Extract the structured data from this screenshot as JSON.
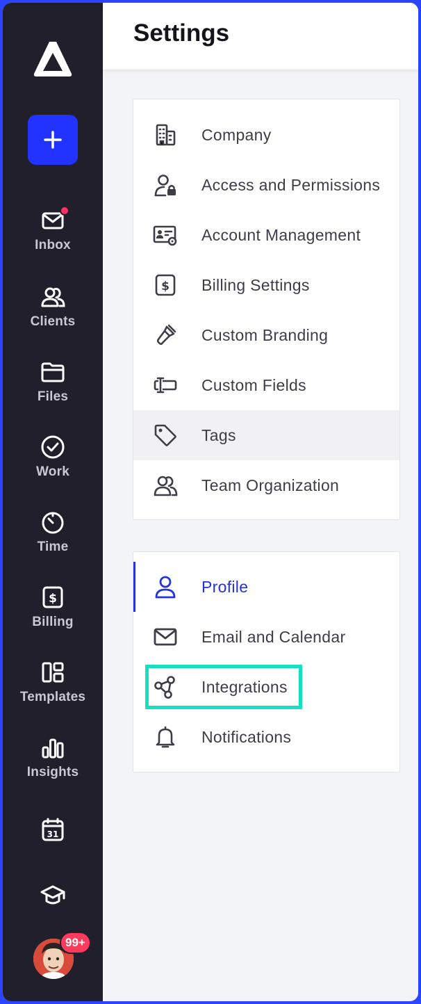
{
  "header": {
    "title": "Settings"
  },
  "sidebar": {
    "new_button": "+",
    "items": [
      {
        "label": "Inbox",
        "icon": "mail-icon"
      },
      {
        "label": "Clients",
        "icon": "users-icon"
      },
      {
        "label": "Files",
        "icon": "folder-icon"
      },
      {
        "label": "Work",
        "icon": "check-circle-icon"
      },
      {
        "label": "Time",
        "icon": "timer-icon"
      },
      {
        "label": "Billing",
        "icon": "dollar-square-icon"
      },
      {
        "label": "Templates",
        "icon": "templates-icon"
      },
      {
        "label": "Insights",
        "icon": "bar-chart-icon"
      }
    ],
    "calendar_day": "31",
    "notification_count": "99+"
  },
  "firm_settings": [
    {
      "label": "Company",
      "icon": "building-icon"
    },
    {
      "label": "Access and Permissions",
      "icon": "user-lock-icon"
    },
    {
      "label": "Account Management",
      "icon": "id-card-gear-icon"
    },
    {
      "label": "Billing Settings",
      "icon": "dollar-square-icon"
    },
    {
      "label": "Custom Branding",
      "icon": "paint-brush-icon"
    },
    {
      "label": "Custom Fields",
      "icon": "text-field-icon"
    },
    {
      "label": "Tags",
      "icon": "tag-icon"
    },
    {
      "label": "Team Organization",
      "icon": "team-icon"
    }
  ],
  "personal_settings": [
    {
      "label": "Profile",
      "icon": "user-icon"
    },
    {
      "label": "Email and Calendar",
      "icon": "mail-icon"
    },
    {
      "label": "Integrations",
      "icon": "share-nodes-icon"
    },
    {
      "label": "Notifications",
      "icon": "bell-icon"
    }
  ],
  "colors": {
    "sidebar_bg": "#201f2b",
    "accent": "#2233ff",
    "highlight": "#16e0c2",
    "badge": "#ff3a5c"
  }
}
